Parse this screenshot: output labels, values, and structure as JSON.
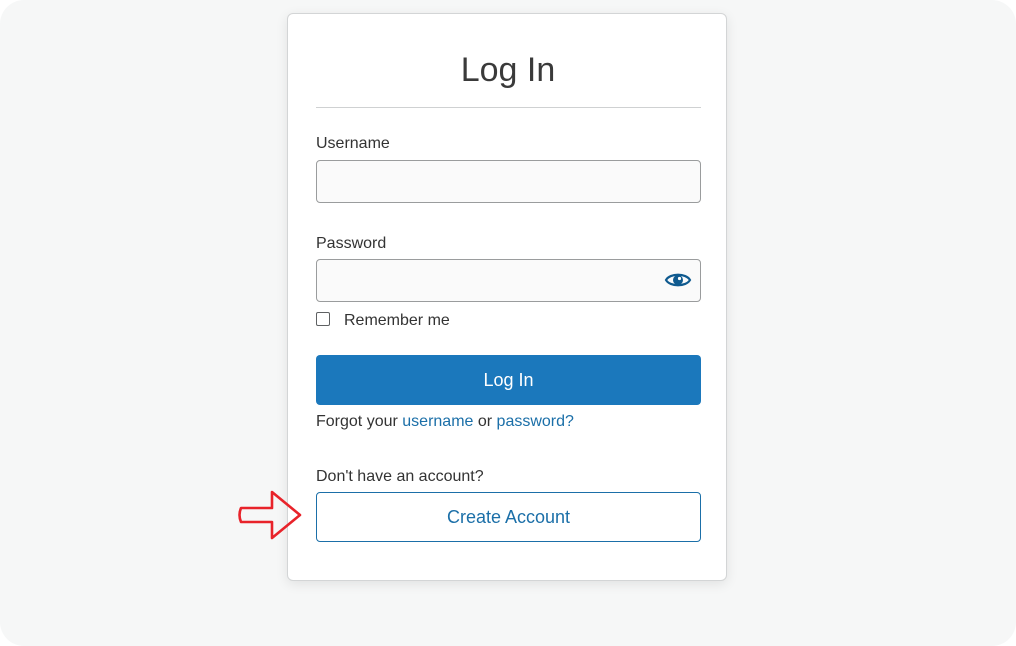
{
  "card": {
    "title": "Log In"
  },
  "username": {
    "label": "Username",
    "value": ""
  },
  "password": {
    "label": "Password",
    "value": "",
    "toggle_icon": "eye-icon"
  },
  "remember": {
    "label": "Remember me",
    "checked": false
  },
  "login_button": {
    "label": "Log In"
  },
  "forgot": {
    "prefix": "Forgot your ",
    "username_link": "username",
    "connector": " or ",
    "password_link": "password?"
  },
  "signup": {
    "prompt": "Don't have an account?",
    "button_label": "Create Account"
  },
  "annotation": {
    "icon": "arrow-right-icon"
  },
  "colors": {
    "primary": "#1b78bc",
    "link": "#1b6fa8",
    "annotation": "#e8232a",
    "backdrop": "#f6f7f7"
  }
}
